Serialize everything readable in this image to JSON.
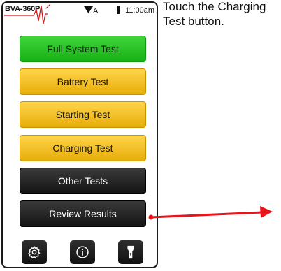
{
  "device": {
    "brand": "BVA-360P",
    "signal_label": "A",
    "time": "11:00am"
  },
  "menu": {
    "full_system_test": "Full System Test",
    "battery_test": "Battery Test",
    "starting_test": "Starting Test",
    "charging_test": "Charging Test",
    "other_tests": "Other Tests",
    "review_results": "Review Results"
  },
  "toolbar": {
    "icons": [
      "gear-icon",
      "info-icon",
      "flashlight-icon"
    ]
  },
  "instruction": {
    "text": "Touch the Charging Test button."
  },
  "colors": {
    "green": "#1fbf1c",
    "yellow": "#f2c020",
    "dark": "#1f1f1f",
    "arrow": "#e8141a"
  }
}
